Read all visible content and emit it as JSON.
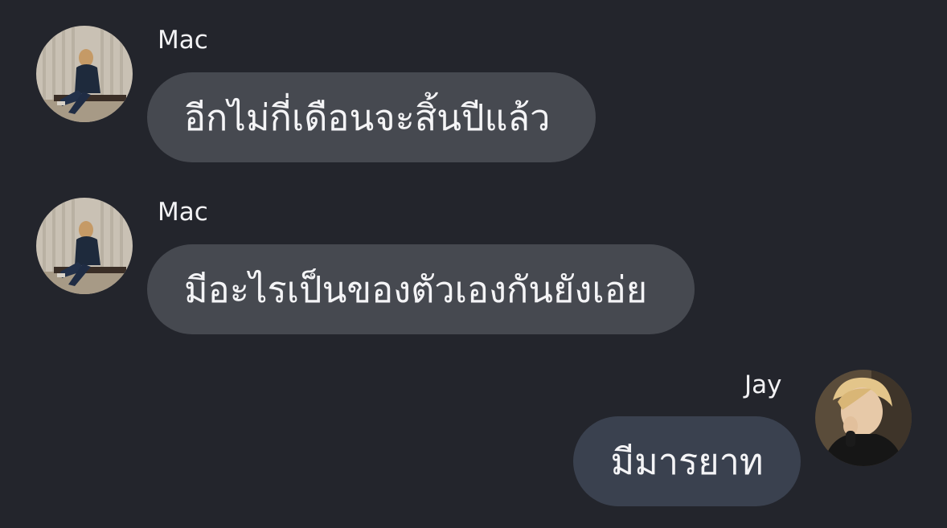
{
  "messages": [
    {
      "sender": "Mac",
      "text": "อีกไม่กี่เดือนจะสิ้นปีแล้ว",
      "direction": "incoming"
    },
    {
      "sender": "Mac",
      "text": "มีอะไรเป็นของตัวเองกันยังเอ่ย",
      "direction": "incoming"
    },
    {
      "sender": "Jay",
      "text": "มีมารยาท",
      "direction": "outgoing"
    }
  ],
  "colors": {
    "background": "#23252c",
    "incoming_bubble": "#464950",
    "outgoing_bubble": "#3a414f",
    "text": "#f4f4f6"
  }
}
